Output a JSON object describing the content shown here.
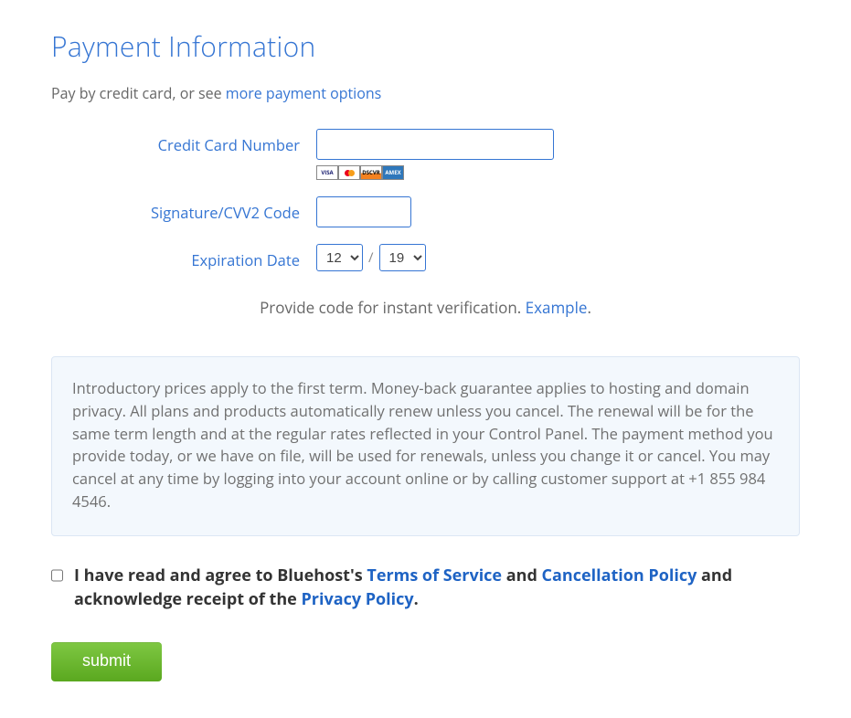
{
  "heading": "Payment Information",
  "intro_text_prefix": "Pay by credit card, or see ",
  "intro_link": "more payment options",
  "labels": {
    "card_number": "Credit Card Number",
    "cvv": "Signature/CVV2 Code",
    "expiration": "Expiration Date"
  },
  "form": {
    "card_number_value": "",
    "cvv_value": "",
    "exp_month": "12",
    "exp_year": "19",
    "slash": "/"
  },
  "card_icons": [
    "visa",
    "mastercard",
    "discover",
    "amex"
  ],
  "verify_prefix": "Provide code for instant verification. ",
  "verify_link": "Example",
  "verify_suffix": ".",
  "disclosure": "Introductory prices apply to the first term. Money-back guarantee applies to hosting and domain privacy. All plans and products automatically renew unless you cancel. The renewal will be for the same term length and at the regular rates reflected in your Control Panel. The payment method you provide today, or we have on file, will be used for renewals, unless you change it or cancel. You may cancel at any time by logging into your account online or by calling customer support at +1 855 984 4546.",
  "agree": {
    "prefix": "I have read and agree to Bluehost's ",
    "tos": "Terms of Service",
    "mid1": " and ",
    "cancel": "Cancellation Policy",
    "mid2": " and acknowledge receipt of the ",
    "privacy": "Privacy Policy",
    "suffix": "."
  },
  "submit_label": "submit"
}
